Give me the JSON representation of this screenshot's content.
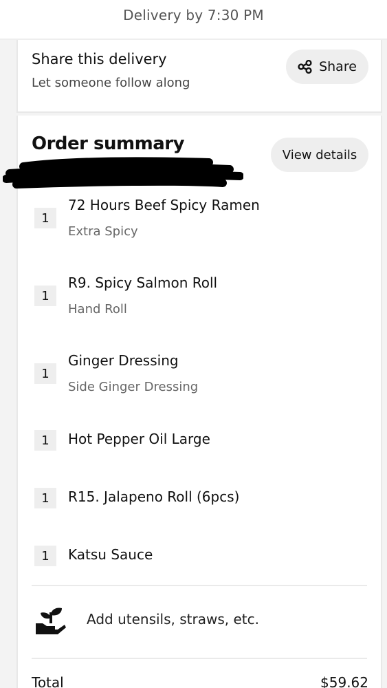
{
  "header": {
    "delivery_eta": "Delivery by 7:30 PM"
  },
  "share": {
    "title": "Share this delivery",
    "subtitle": "Let someone follow along",
    "button_label": "Share",
    "button_icon": "share-nodes-icon"
  },
  "summary": {
    "title": "Order summary",
    "view_details_label": "View details",
    "items": [
      {
        "qty": "1",
        "name": "72 Hours Beef Spicy Ramen",
        "option": "Extra Spicy"
      },
      {
        "qty": "1",
        "name": "R9. Spicy Salmon Roll",
        "option": "Hand Roll"
      },
      {
        "qty": "1",
        "name": "Ginger Dressing",
        "option": "Side Ginger Dressing"
      },
      {
        "qty": "1",
        "name": "Hot Pepper Oil Large",
        "option": ""
      },
      {
        "qty": "1",
        "name": "R15. Jalapeno Roll (6pcs)",
        "option": ""
      },
      {
        "qty": "1",
        "name": "Katsu Sauce",
        "option": ""
      }
    ],
    "utensils_label": "Add utensils, straws, etc.",
    "utensils_icon": "plant-in-hand-icon",
    "total_label": "Total",
    "total_value": "$59.62"
  },
  "colors": {
    "background": "#f3f3f3",
    "card": "#ffffff",
    "pill": "#eeeeee",
    "text_primary": "#111111",
    "text_secondary": "#666666",
    "redaction": "#000000"
  }
}
